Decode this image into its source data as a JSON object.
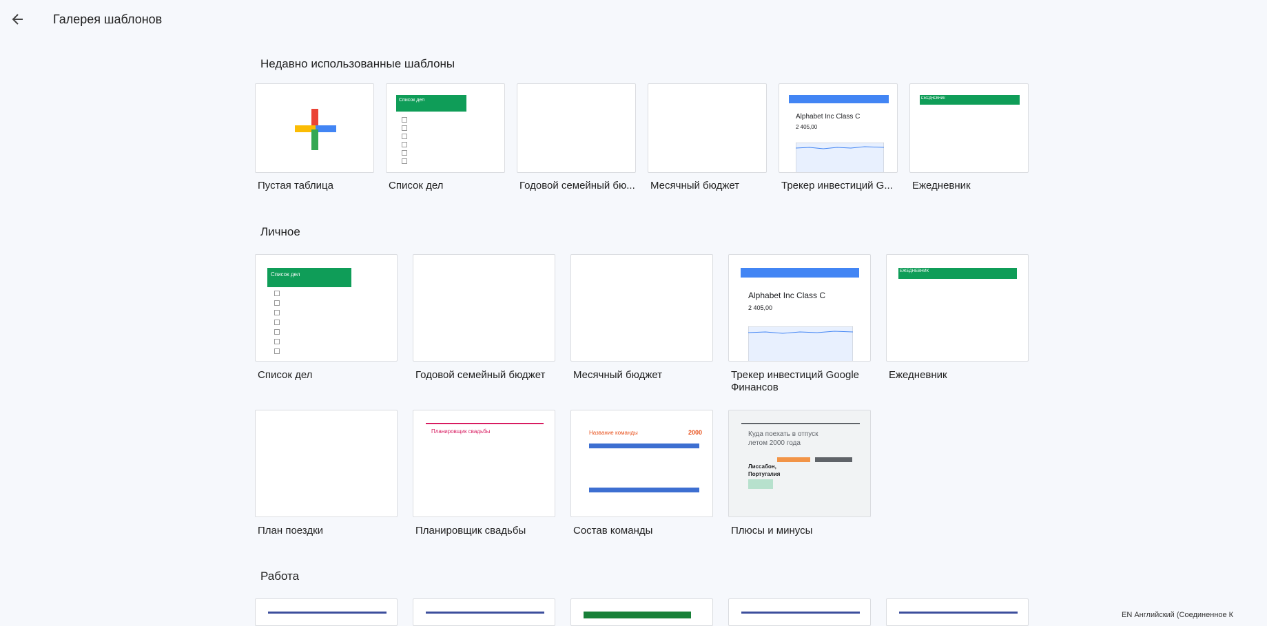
{
  "header": {
    "title": "Галерея шаблонов"
  },
  "recent": {
    "title": "Недавно использованные шаблоны",
    "items": [
      {
        "label": "Пустая таблица"
      },
      {
        "label": "Список дел"
      },
      {
        "label": "Годовой семейный бю..."
      },
      {
        "label": "Месячный бюджет"
      },
      {
        "label": "Трекер инвестиций G..."
      },
      {
        "label": "Ежедневник"
      }
    ]
  },
  "personal": {
    "title": "Личное",
    "items": [
      {
        "label": "Список дел"
      },
      {
        "label": "Годовой семейный бюджет"
      },
      {
        "label": "Месячный бюджет"
      },
      {
        "label": "Трекер инвестиций Google Финансов"
      },
      {
        "label": "Ежедневник"
      },
      {
        "label": "План поездки"
      },
      {
        "label": "Планировщик свадьбы"
      },
      {
        "label": "Состав команды"
      },
      {
        "label": "Плюсы и минусы"
      }
    ]
  },
  "work": {
    "title": "Работа"
  },
  "thumbs": {
    "todo_title": "Список дел",
    "invest_name": "Alphabet Inc Class C",
    "invest_price": "2 405,00",
    "team_title": "Название команды",
    "team_year": "2000",
    "pros_title": "Куда поехать в отпуск летом 2000 года",
    "pros_city": "Лиссабон, Португалия",
    "wedding_title": "Планировщик свадьбы",
    "diary_title": "ЕЖЕДНЕВНИК"
  },
  "footer": {
    "lang": "EN Английский (Соединенное К"
  },
  "colors": {
    "background": "#f6f8fc",
    "green": "#0f9d58",
    "blue": "#4285f4",
    "red": "#ea4335",
    "yellow": "#fbbc04"
  }
}
